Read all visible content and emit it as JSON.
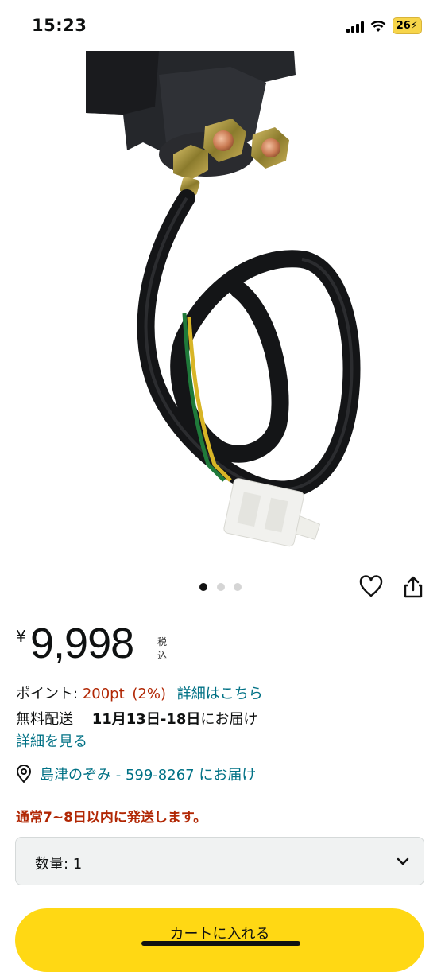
{
  "status": {
    "time": "15:23",
    "battery": "26"
  },
  "carousel": {
    "count": 3,
    "active": 0
  },
  "price": {
    "symbol": "¥",
    "value": "9,998",
    "tax": "税込"
  },
  "points": {
    "label": "ポイント:",
    "value": "200pt",
    "percent": "(2%)",
    "link": "詳細はこちら"
  },
  "delivery": {
    "label": "無料配送",
    "dates": "11月13日-18日",
    "suffix": "にお届け",
    "details_link": "詳細を見る"
  },
  "location": {
    "text": "島津のぞみ - 599-8267 にお届け"
  },
  "shipping_note": "通常7~8日以内に発送します。",
  "quantity": {
    "label": "数量: 1"
  },
  "cart_button": {
    "label": "カートに入れる"
  }
}
